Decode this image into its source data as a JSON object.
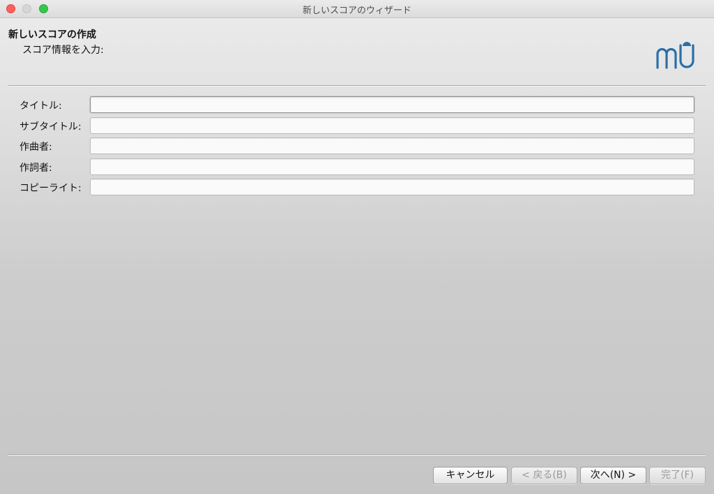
{
  "window": {
    "title": "新しいスコアのウィザード"
  },
  "header": {
    "title": "新しいスコアの作成",
    "subtitle": "スコア情報を入力:",
    "logo_icon": "musescore-logo-icon",
    "logo_color": "#2a6fa8"
  },
  "form": {
    "fields": [
      {
        "label": "タイトル:",
        "value": "",
        "focused": true
      },
      {
        "label": "サブタイトル:",
        "value": ""
      },
      {
        "label": "作曲者:",
        "value": ""
      },
      {
        "label": "作詞者:",
        "value": ""
      },
      {
        "label": "コピーライト:",
        "value": ""
      }
    ]
  },
  "buttons": {
    "cancel": "キャンセル",
    "back": "< 戻る(B)",
    "next": "次へ(N) >",
    "finish": "完了(F)"
  },
  "colors": {
    "close": "#fc605b",
    "minimize": "#d6d6d6",
    "zoom": "#34c84a"
  }
}
